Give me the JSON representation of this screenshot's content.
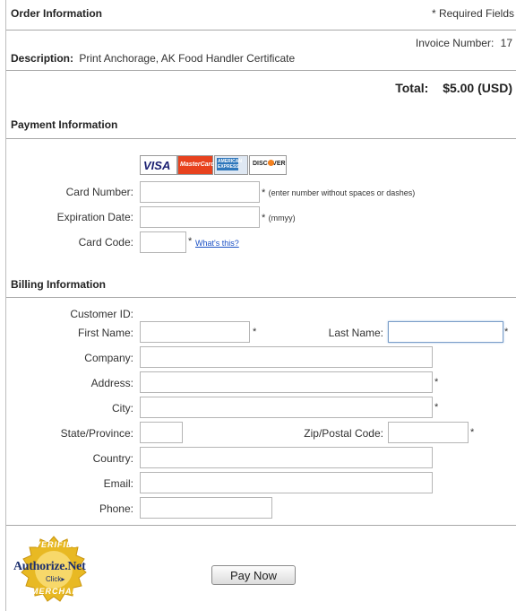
{
  "order": {
    "title": "Order Information",
    "required_note": "* Required Fields",
    "invoice_label": "Invoice Number:",
    "invoice_value": "17",
    "description_label": "Description:",
    "description_value": "Print Anchorage, AK Food Handler Certificate",
    "total_label": "Total:",
    "total_value": "$5.00 (USD)"
  },
  "payment": {
    "title": "Payment Information",
    "cards": [
      {
        "name": "visa",
        "text": "VISA",
        "color": "#1a1f71"
      },
      {
        "name": "mastercard",
        "text": "MasterCard",
        "color": "#eb001b"
      },
      {
        "name": "american-express",
        "text": "AMERICAN EXPRESS",
        "color": "#2e77bc"
      },
      {
        "name": "discover",
        "text": "DISCOVER",
        "color": "#f58220"
      }
    ],
    "card_number_label": "Card Number:",
    "card_number_value": "",
    "card_number_note": "(enter number without spaces or dashes)",
    "expiration_label": "Expiration Date:",
    "expiration_value": "",
    "expiration_note": "(mmyy)",
    "card_code_label": "Card Code:",
    "card_code_value": "",
    "whats_this": "What's this?"
  },
  "billing": {
    "title": "Billing Information",
    "customer_id_label": "Customer ID:",
    "first_name_label": "First Name:",
    "last_name_label": "Last Name:",
    "company_label": "Company:",
    "address_label": "Address:",
    "city_label": "City:",
    "state_label": "State/Province:",
    "zip_label": "Zip/Postal Code:",
    "country_label": "Country:",
    "email_label": "Email:",
    "phone_label": "Phone:",
    "required_star": "*"
  },
  "seal": {
    "top_text": "VERIFIED",
    "brand": "Authorize.Net",
    "click": "Click",
    "bottom_text": "MERCHANT",
    "colors": {
      "gold": "#e8b923",
      "navy": "#1c2f6e"
    }
  },
  "actions": {
    "pay_now": "Pay Now"
  }
}
